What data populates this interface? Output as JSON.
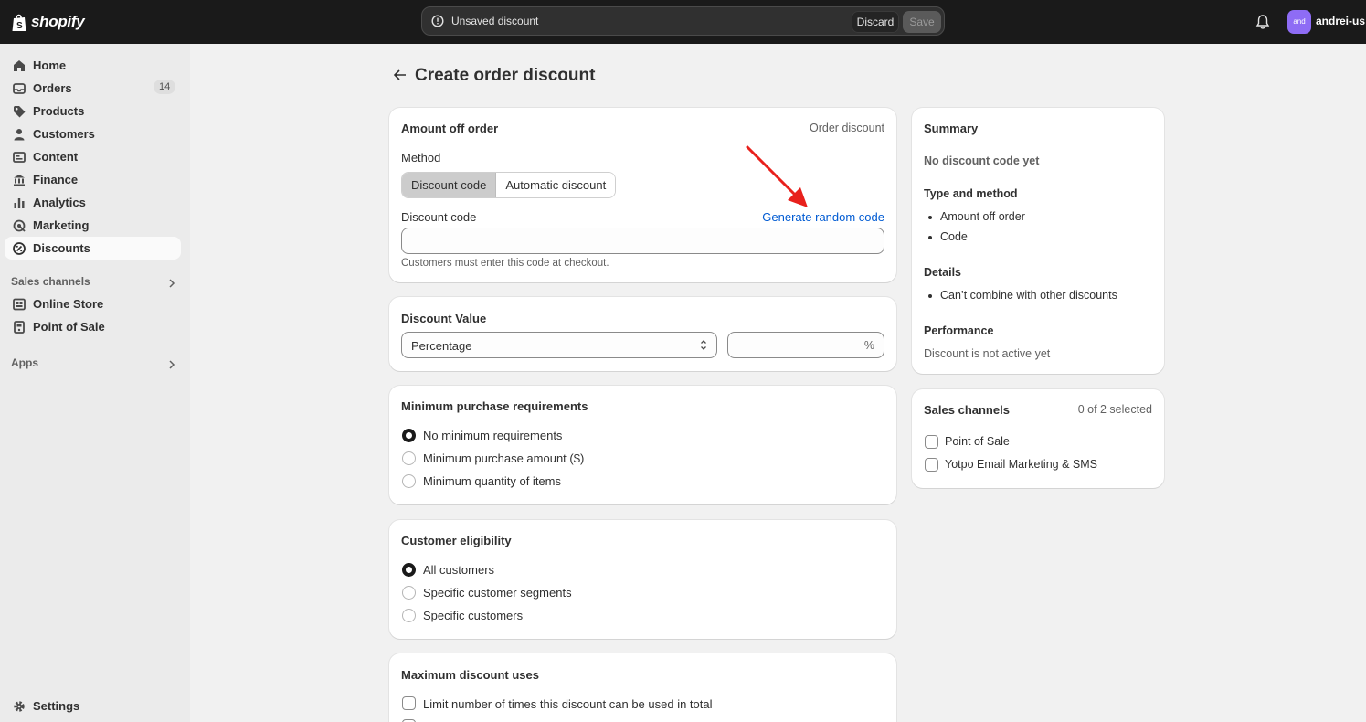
{
  "topbar": {
    "logo_text": "shopify",
    "unsaved_text": "Unsaved discount",
    "discard_label": "Discard",
    "save_label": "Save",
    "avatar_initials": "and",
    "username": "andrei-us"
  },
  "sidebar": {
    "items": [
      {
        "label": "Home",
        "icon": "home-icon"
      },
      {
        "label": "Orders",
        "icon": "orders-icon",
        "badge": "14"
      },
      {
        "label": "Products",
        "icon": "tag-icon"
      },
      {
        "label": "Customers",
        "icon": "person-icon"
      },
      {
        "label": "Content",
        "icon": "content-icon"
      },
      {
        "label": "Finance",
        "icon": "bank-icon"
      },
      {
        "label": "Analytics",
        "icon": "bar-chart-icon"
      },
      {
        "label": "Marketing",
        "icon": "target-icon"
      },
      {
        "label": "Discounts",
        "icon": "discount-icon",
        "active": true
      }
    ],
    "sales_channels_label": "Sales channels",
    "channels": [
      {
        "label": "Online Store",
        "icon": "store-icon"
      },
      {
        "label": "Point of Sale",
        "icon": "pos-icon"
      }
    ],
    "apps_label": "Apps",
    "settings_label": "Settings"
  },
  "page": {
    "title": "Create order discount"
  },
  "amount_card": {
    "title": "Amount off order",
    "type_label": "Order discount",
    "method_label": "Method",
    "method_options": [
      "Discount code",
      "Automatic discount"
    ],
    "selected_method": "Discount code",
    "code_label": "Discount code",
    "generate_link": "Generate random code",
    "code_value": "",
    "help_text": "Customers must enter this code at checkout."
  },
  "value_card": {
    "title": "Discount Value",
    "type_value": "Percentage",
    "amount_value": "",
    "suffix": "%"
  },
  "min_card": {
    "title": "Minimum purchase requirements",
    "options": [
      "No minimum requirements",
      "Minimum purchase amount ($)",
      "Minimum quantity of items"
    ],
    "selected_index": 0
  },
  "eligibility_card": {
    "title": "Customer eligibility",
    "options": [
      "All customers",
      "Specific customer segments",
      "Specific customers"
    ],
    "selected_index": 0
  },
  "max_card": {
    "title": "Maximum discount uses",
    "options": [
      "Limit number of times this discount can be used in total"
    ]
  },
  "summary": {
    "title": "Summary",
    "code_status": "No discount code yet",
    "type_heading": "Type and method",
    "type_items": [
      "Amount off order",
      "Code"
    ],
    "details_heading": "Details",
    "details_items": [
      "Can’t combine with other discounts"
    ],
    "performance_heading": "Performance",
    "performance_text": "Discount is not active yet"
  },
  "sales_channels": {
    "title": "Sales channels",
    "count_text": "0 of 2 selected",
    "options": [
      "Point of Sale",
      "Yotpo Email Marketing & SMS"
    ]
  },
  "colors": {
    "topbar": "#1a1a1a",
    "link": "#005bd3",
    "annotation_arrow": "#e8201c"
  }
}
